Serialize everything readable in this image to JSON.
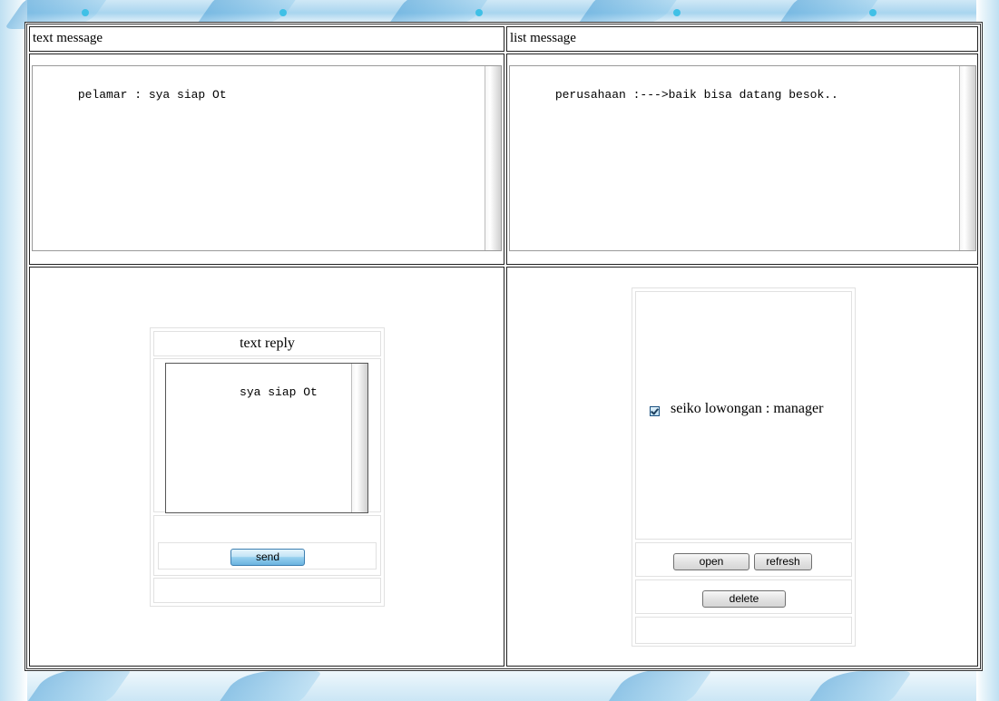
{
  "left": {
    "header": "text message",
    "message_text": "pelamar : sya siap Ot",
    "reply": {
      "title": "text reply",
      "value": "sya siap Ot",
      "send_label": "send"
    }
  },
  "right": {
    "header": "list message",
    "message_text": "perusahaan :--->baik bisa datang besok..",
    "list_item": {
      "label": "seiko lowongan : manager",
      "checked": true
    },
    "open_label": "open",
    "refresh_label": "refresh",
    "delete_label": "delete"
  },
  "colors": {
    "send_button": "#98d1ef",
    "border": "#222222",
    "background_accent": "#a9d5ef"
  },
  "icons": {
    "checkbox": "checkbox-checked-icon"
  }
}
